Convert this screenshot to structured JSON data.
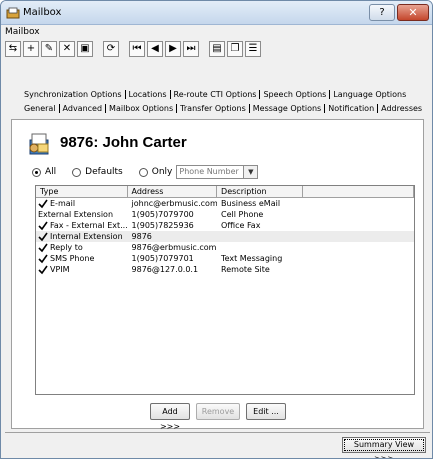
{
  "window": {
    "title": "Mailbox"
  },
  "menubar": {
    "label": "Mailbox"
  },
  "tabs_row1": [
    "Synchronization Options",
    "Locations",
    "Re-route CTI Options",
    "Speech Options",
    "Language Options"
  ],
  "tabs_row2": [
    "General",
    "Advanced",
    "Mailbox Options",
    "Transfer Options",
    "Message Options",
    "Notification",
    "Addresses"
  ],
  "mailbox": {
    "title": "9876: John Carter"
  },
  "filter": {
    "all_label": "All",
    "defaults_label": "Defaults",
    "only_label": "Only",
    "select_value": "Phone Number"
  },
  "grid": {
    "columns": [
      "Type",
      "Address",
      "Description"
    ],
    "rows": [
      {
        "type": "E-mail",
        "address": "johnc@erbmusic.com",
        "description": "Business eMail",
        "checked": true
      },
      {
        "type": "External Extension",
        "address": "1(905)7079700",
        "description": "Cell Phone",
        "checked": false
      },
      {
        "type": "Fax - External Ext...",
        "address": "1(905)7825936",
        "description": "Office Fax",
        "checked": true
      },
      {
        "type": "Internal Extension",
        "address": "9876",
        "description": "",
        "checked": true
      },
      {
        "type": "Reply to",
        "address": "9876@erbmusic.com",
        "description": "",
        "checked": true
      },
      {
        "type": "SMS Phone",
        "address": "1(905)7079701",
        "description": "Text Messaging",
        "checked": true
      },
      {
        "type": "VPIM",
        "address": "9876@127.0.0.1",
        "description": "Remote Site",
        "checked": true
      }
    ]
  },
  "buttons": {
    "add": "Add >>>",
    "remove": "Remove",
    "edit": "Edit ..."
  },
  "summary": {
    "label": "Summary View >>>"
  }
}
